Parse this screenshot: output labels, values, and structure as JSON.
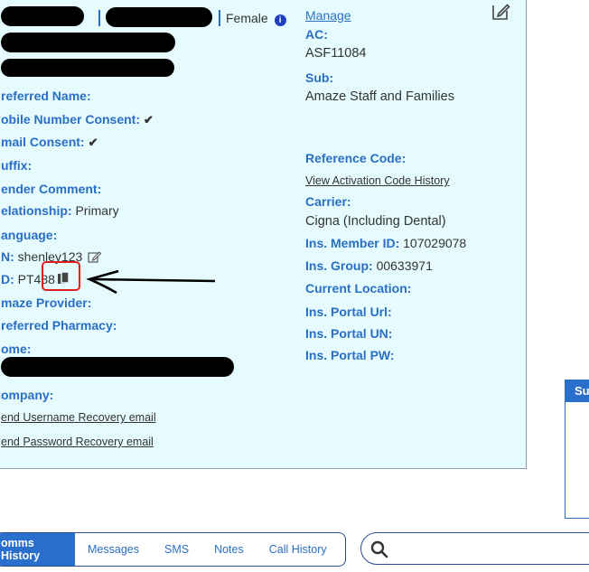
{
  "header": {
    "gender": "Female"
  },
  "left": {
    "preferred_name": "referred Name:",
    "mobile_consent": "obile Number Consent:",
    "email_consent": "mail Consent:",
    "suffix": "uffix:",
    "gender_comment": "ender Comment:",
    "relationship_label": "elationship:",
    "relationship_value": "Primary",
    "language": "anguage:",
    "un_label": "N:",
    "un_value": "shenley123",
    "id_label": "D:",
    "id_value": "PT488",
    "amaze_provider": "maze Provider:",
    "preferred_pharmacy": "referred Pharmacy:",
    "home": "ome:",
    "company": "ompany:",
    "send_username": "end Username Recovery email",
    "send_password": "end Password Recovery email"
  },
  "right": {
    "manage": "Manage",
    "ac_label": "AC:",
    "ac_value": "ASF11084",
    "sub_label": "Sub:",
    "sub_value": "Amaze Staff and Families",
    "reference_code": "Reference Code:",
    "view_activation": "View Activation Code History",
    "carrier_label": "Carrier:",
    "carrier_value": "Cigna (Including Dental)",
    "member_id_label": "Ins. Member ID:",
    "member_id_value": "107029078",
    "group_label": "Ins. Group:",
    "group_value": "00633971",
    "current_location": "Current Location:",
    "portal_url": "Ins. Portal Url:",
    "portal_un": "Ins. Portal UN:",
    "portal_pw": "Ins. Portal PW:"
  },
  "tabs": [
    {
      "label": "omms History",
      "active": true
    },
    {
      "label": "Messages",
      "active": false
    },
    {
      "label": "SMS",
      "active": false
    },
    {
      "label": "Notes",
      "active": false
    },
    {
      "label": "Call History",
      "active": false
    }
  ],
  "sidebox": {
    "title": "Su"
  },
  "colors": {
    "accent": "#2b6fcd",
    "label": "#2a6fc6",
    "panel_bg": "#e6fbfd",
    "annotation": "#e02020"
  }
}
